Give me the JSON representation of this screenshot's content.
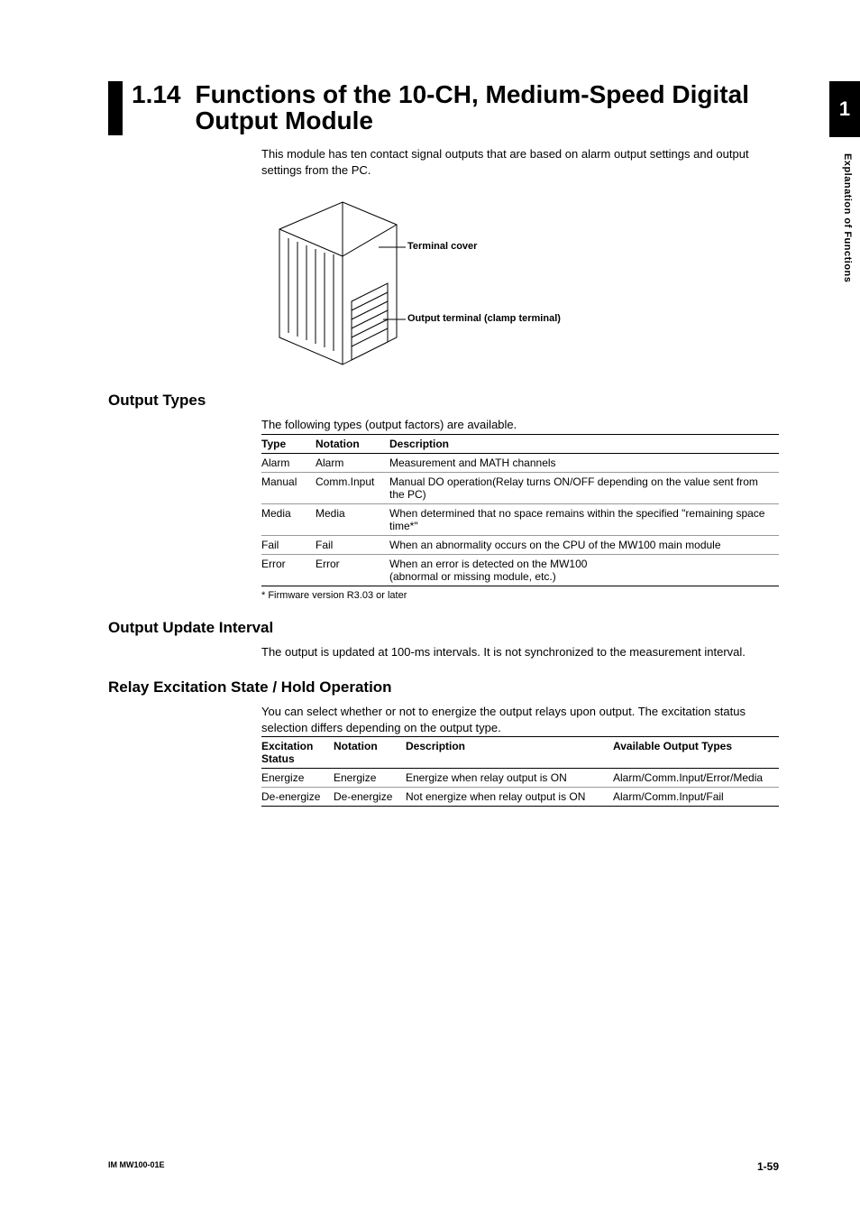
{
  "side": {
    "chapter": "1",
    "label": "Explanation of Functions"
  },
  "title": {
    "num": "1.14",
    "text": "Functions of the 10-CH, Medium-Speed Digital Output Module"
  },
  "intro": "This module has ten contact signal outputs that are based on alarm output settings and output settings from the PC.",
  "fig": {
    "label1": "Terminal cover",
    "label2": "Output terminal (clamp terminal)"
  },
  "s1": {
    "heading": "Output Types",
    "lead": "The following types (output factors) are available.",
    "head": {
      "c1": "Type",
      "c2": "Notation",
      "c3": "Description"
    },
    "rows": [
      {
        "c1": "Alarm",
        "c2": "Alarm",
        "c3": "Measurement and MATH channels"
      },
      {
        "c1": "Manual",
        "c2": "Comm.Input",
        "c3": "Manual DO operation(Relay turns ON/OFF depending on the value sent from the PC)"
      },
      {
        "c1": "Media",
        "c2": "Media",
        "c3": "When determined that no space remains within the specified \"remaining space time*\""
      },
      {
        "c1": "Fail",
        "c2": "Fail",
        "c3": "When an abnormality occurs on the CPU of the MW100 main module"
      },
      {
        "c1": "Error",
        "c2": "Error",
        "c3": "When an error is detected on the MW100\n(abnormal or missing module, etc.)"
      }
    ],
    "footnote": "*  Firmware version R3.03 or later"
  },
  "s2": {
    "heading": "Output Update Interval",
    "body": "The output is updated at 100-ms intervals. It is not synchronized to the measurement interval."
  },
  "s3": {
    "heading": "Relay Excitation State / Hold Operation",
    "lead": "You can select whether or not to energize the output relays upon output. The excitation status selection differs depending on the output type.",
    "head": {
      "c1": "Excitation Status",
      "c2": "Notation",
      "c3": "Description",
      "c4": "Available Output Types"
    },
    "rows": [
      {
        "c1": "Energize",
        "c2": "Energize",
        "c3": "Energize when relay output is ON",
        "c4": "Alarm/Comm.Input/Error/Media"
      },
      {
        "c1": "De-energize",
        "c2": "De-energize",
        "c3": "Not energize when relay output is ON",
        "c4": "Alarm/Comm.Input/Fail"
      }
    ]
  },
  "footer": {
    "docid": "IM MW100-01E",
    "pagenum": "1-59"
  }
}
